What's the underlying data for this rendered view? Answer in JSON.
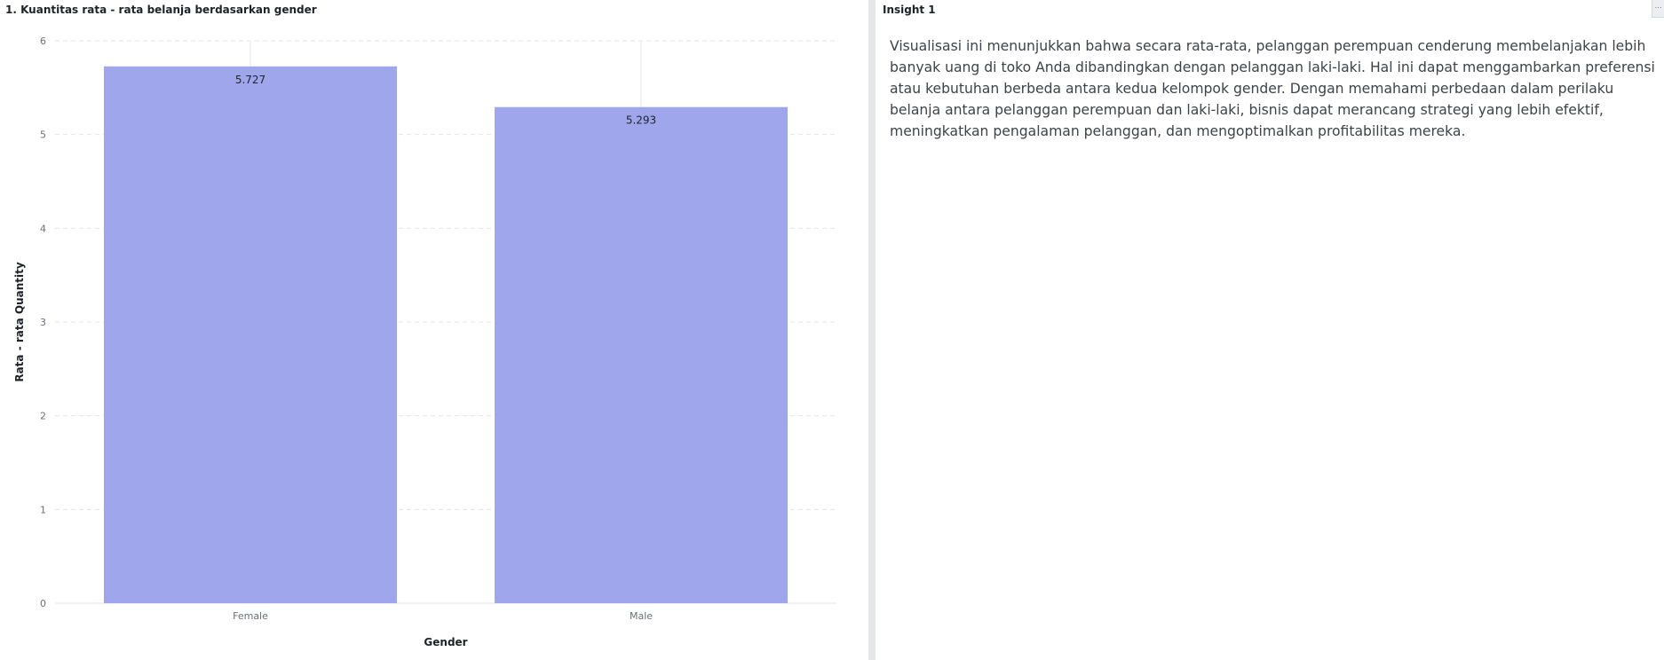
{
  "chart_panel": {
    "title": "1. Kuantitas rata - rata belanja berdasarkan gender"
  },
  "insight_panel": {
    "title": "Insight 1",
    "body": "Visualisasi ini menunjukkan bahwa secara rata-rata, pelanggan perempuan cenderung membelanjakan lebih banyak uang di toko Anda dibandingkan dengan pelanggan laki-laki. Hal ini dapat menggambarkan preferensi atau kebutuhan berbeda antara kedua kelompok gender. Dengan memahami perbedaan dalam perilaku belanja antara pelanggan perempuan dan laki-laki, bisnis dapat merancang strategi yang lebih efektif, meningkatkan pengalaman pelanggan, dan mengoptimalkan profitabilitas mereka."
  },
  "colors": {
    "bar": "#a0a6ec",
    "grid": "#e3e5e8",
    "axis_text": "#6b6f76",
    "label_text": "#1f2328"
  },
  "chart_data": {
    "type": "bar",
    "categories": [
      "Female",
      "Male"
    ],
    "values": [
      5.727,
      5.293
    ],
    "data_labels": [
      "5.727",
      "5.293"
    ],
    "title": "1. Kuantitas rata - rata belanja berdasarkan gender",
    "xlabel": "Gender",
    "ylabel": "Rata - rata Quantity",
    "ylim": [
      0,
      6
    ],
    "yticks": [
      0,
      1,
      2,
      3,
      4,
      5,
      6
    ],
    "grid": true,
    "legend": "none"
  }
}
